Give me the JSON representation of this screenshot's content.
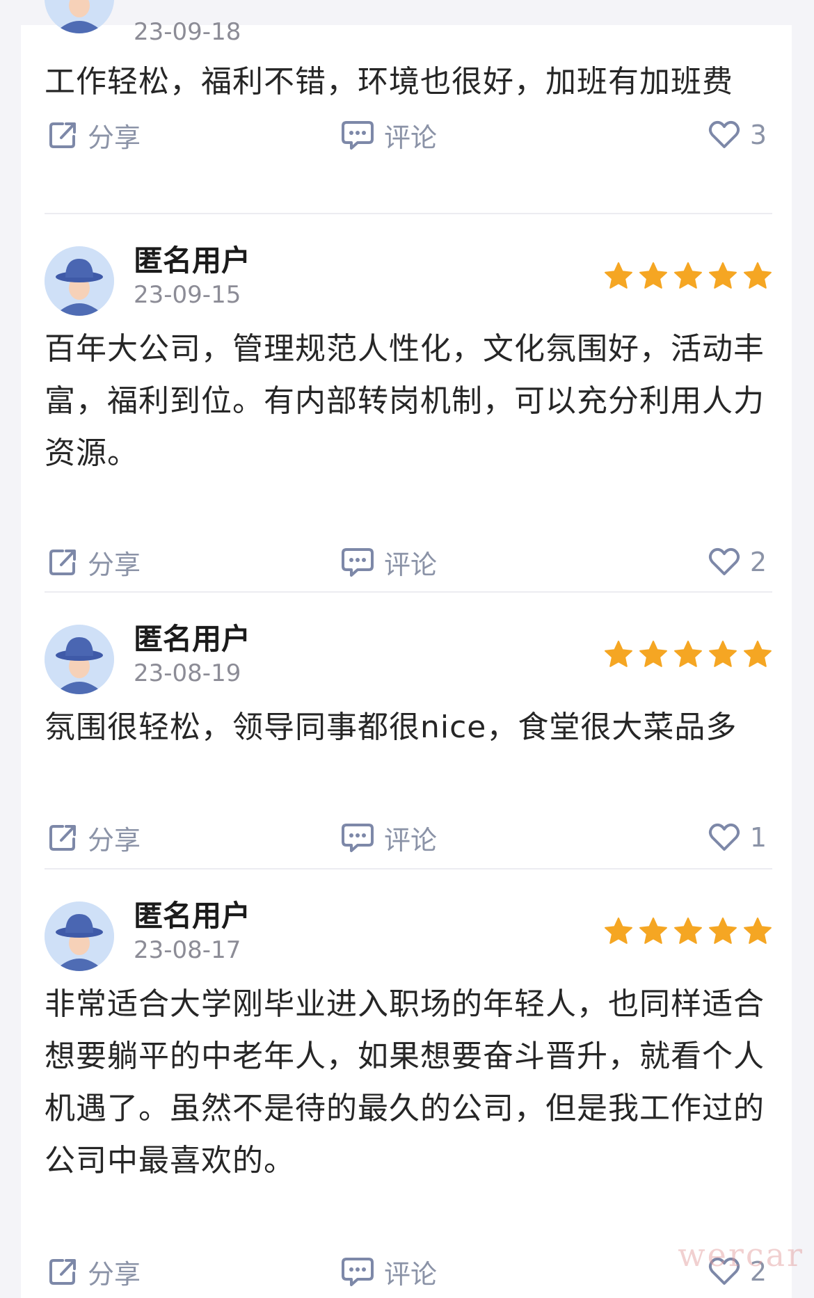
{
  "reviews": [
    {
      "user": "",
      "date": "23-09-18",
      "stars": 0,
      "content": "工作轻松，福利不错，环境也很好，加班有加班费",
      "share_label": "分享",
      "comment_label": "评论",
      "likes": "3"
    },
    {
      "user": "匿名用户",
      "date": "23-09-15",
      "stars": 5,
      "content": "百年大公司，管理规范人性化，文化氛围好，活动丰富，福利到位。有内部转岗机制，可以充分利用人力资源。",
      "share_label": "分享",
      "comment_label": "评论",
      "likes": "2"
    },
    {
      "user": "匿名用户",
      "date": "23-08-19",
      "stars": 5,
      "content": "氛围很轻松，领导同事都很nice，食堂很大菜品多",
      "share_label": "分享",
      "comment_label": "评论",
      "likes": "1"
    },
    {
      "user": "匿名用户",
      "date": "23-08-17",
      "stars": 5,
      "content": "非常适合大学刚毕业进入职场的年轻人，也同样适合想要躺平的中老年人，如果想要奋斗晋升，就看个人机遇了。虽然不是待的最久的公司，但是我工作过的公司中最喜欢的。",
      "share_label": "分享",
      "comment_label": "评论",
      "likes": "2"
    }
  ],
  "watermark": "wercar",
  "colors": {
    "star": "#f5a623",
    "icon": "#7d88a8",
    "divider": "#ececf1",
    "date": "#8c8c96"
  }
}
